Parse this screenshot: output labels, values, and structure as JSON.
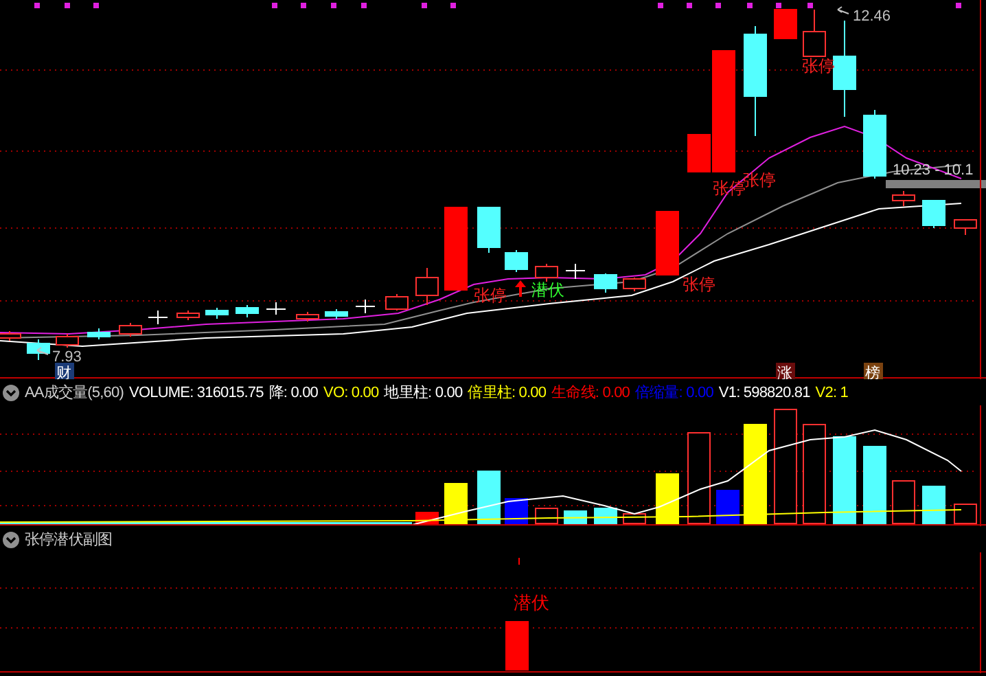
{
  "main_chart": {
    "price_labels": [
      {
        "text": "12.46"
      },
      {
        "text": "10.23 - 10.1"
      },
      {
        "text": "7.93"
      }
    ],
    "signals": [
      {
        "text": "张停",
        "kind": "limit"
      },
      {
        "text": "潜伏",
        "kind": "dormant"
      },
      {
        "text": "张停",
        "kind": "limit"
      },
      {
        "text": "张停",
        "kind": "limit"
      },
      {
        "text": "张停",
        "kind": "limit"
      },
      {
        "text": "张停",
        "kind": "limit"
      }
    ],
    "badges": [
      {
        "text": "财",
        "color": "#1c3c78"
      },
      {
        "text": "涨",
        "color": "#6a0c0c"
      },
      {
        "text": "榜",
        "color": "#7a4210"
      }
    ]
  },
  "volume_panel": {
    "title": "AA成交量(5,60)",
    "readings": [
      {
        "label": "VOLUME:",
        "value": "316015.75",
        "color": "#ffffff"
      },
      {
        "label": "降:",
        "value": "0.00",
        "color": "#ffffff"
      },
      {
        "label": "VO:",
        "value": "0.00",
        "color": "#ffff00"
      },
      {
        "label": "地里柱:",
        "value": "0.00",
        "color": "#ffffff"
      },
      {
        "label": "倍里柱:",
        "value": "0.00",
        "color": "#ffff00"
      },
      {
        "label": "生命线:",
        "value": "0.00",
        "color": "#ff0000"
      },
      {
        "label": "倍缩量:",
        "value": "0.00",
        "color": "#0000ff"
      },
      {
        "label": "V1:",
        "value": "598820.81",
        "color": "#ffffff"
      },
      {
        "label": "V2:",
        "value": "1",
        "color": "#ffff00"
      }
    ]
  },
  "signal_panel": {
    "title": "张停潜伏副图",
    "signals": [
      {
        "text": "潜伏"
      }
    ]
  }
}
